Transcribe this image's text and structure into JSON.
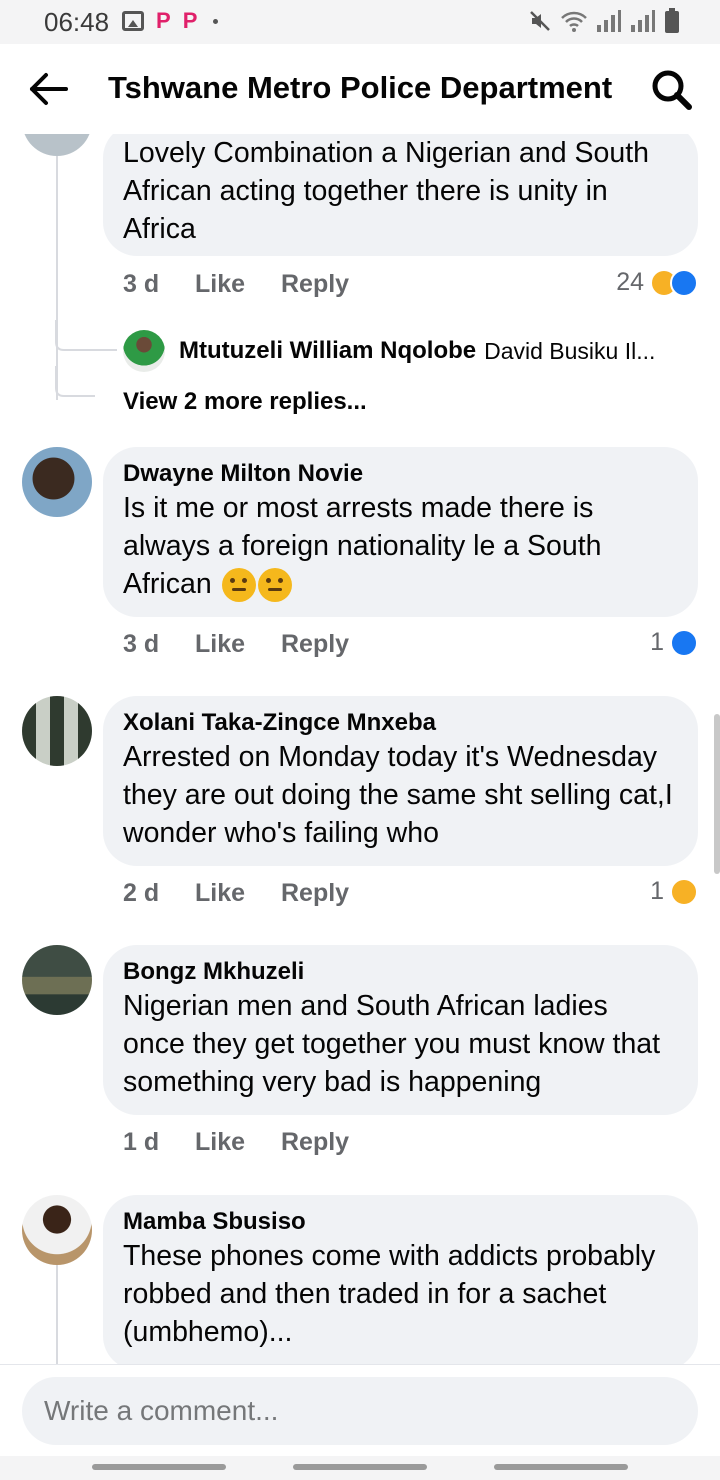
{
  "status_bar": {
    "time": "06:48",
    "notification_letters": [
      "P",
      "P"
    ],
    "icons": [
      "gallery-icon",
      "mute-icon",
      "wifi-icon",
      "signal-icon",
      "battery-icon"
    ]
  },
  "header": {
    "title": "Tshwane Metro Police Department",
    "back_icon": "arrow-left-icon",
    "search_icon": "search-icon"
  },
  "comments": [
    {
      "author": "",
      "text": "Lovely Combination a Nigerian and South African acting together there is unity in Africa",
      "time": "3 d",
      "like_label": "Like",
      "reply_label": "Reply",
      "reaction_count": "24",
      "reactions": [
        "haha",
        "like"
      ],
      "reply_preview": {
        "author": "Mtutuzeli William Nqolobe",
        "text": "David Busiku Il..."
      },
      "view_more": "View 2 more replies..."
    },
    {
      "author": "Dwayne Milton Novie",
      "text": "Is it me or most arrests made there is always a foreign nationality le a South African",
      "time": "3 d",
      "like_label": "Like",
      "reply_label": "Reply",
      "reaction_count": "1",
      "reactions": [
        "like"
      ]
    },
    {
      "author": "Xolani Taka-Zingce Mnxeba",
      "text": "Arrested on Monday  today it's Wednesday they are out doing the same sht selling cat,I wonder who's failing who",
      "time": "2 d",
      "like_label": "Like",
      "reply_label": "Reply",
      "reaction_count": "1",
      "reactions": [
        "sad"
      ]
    },
    {
      "author": "Bongz Mkhuzeli",
      "text": "Nigerian men and South African ladies once they get together you must know that something very bad is happening",
      "time": "1 d",
      "like_label": "Like",
      "reply_label": "Reply"
    },
    {
      "author": "Mamba Sbusiso",
      "text": "These phones come with addicts probably robbed and then traded in for a sachet (umbhemo)..."
    }
  ],
  "composer": {
    "placeholder": "Write a comment..."
  },
  "colors": {
    "bubble": "#f0f2f5",
    "like_blue": "#1877f2",
    "meta_gray": "#65676b"
  }
}
